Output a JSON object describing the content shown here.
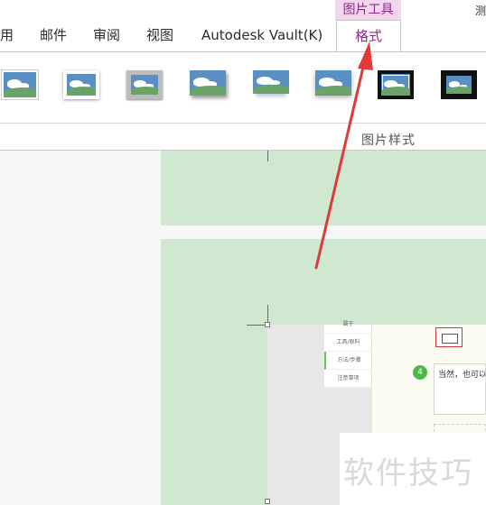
{
  "ribbon": {
    "context_group": "图片工具",
    "corner_text": "测",
    "tabs": [
      "用",
      "邮件",
      "审阅",
      "视图",
      "Autodesk Vault(K)"
    ],
    "active_tab": "格式",
    "gallery_group_label": "图片样式"
  },
  "document": {
    "side_menu": [
      "属于",
      "工具/原料",
      "方法/步骤",
      "注意事项"
    ],
    "step_number": "4",
    "step_text": "当然，也可以",
    "watermark": "软件技巧"
  },
  "colors": {
    "accent": "#8c2a8a",
    "context_band": "#f2d6ef",
    "page_fill": "#cfe8cf",
    "arrow": "#e03a3a"
  }
}
